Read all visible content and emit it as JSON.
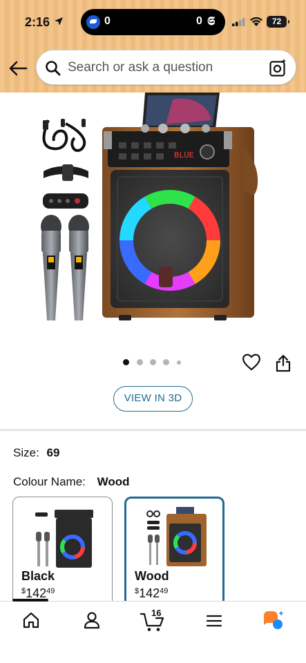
{
  "status_bar": {
    "time": "2:16",
    "score_left": "0",
    "score_right": "0",
    "battery": "72"
  },
  "search": {
    "placeholder": "Search or ask a question"
  },
  "gallery": {
    "dot_count": 5,
    "active_index": 0,
    "view_3d_label": "VIEW IN 3D",
    "speaker_display_text": "BLUE"
  },
  "product": {
    "size_label": "Size:",
    "size_value": "69",
    "colour_label": "Colour Name:",
    "colour_value": "Wood",
    "variants": [
      {
        "name": "Black",
        "currency": "$",
        "price_whole": "142",
        "price_cents": "49",
        "selected": false
      },
      {
        "name": "Wood",
        "currency": "$",
        "price_whole": "142",
        "price_cents": "49",
        "selected": true
      }
    ]
  },
  "bottom_nav": {
    "items": [
      "home-icon",
      "account-icon",
      "cart-icon",
      "menu-icon",
      "rufus-icon"
    ],
    "cart_count": "16",
    "active": "home"
  },
  "colors": {
    "accent": "#1f6a8f",
    "header_bg": "#f3c58b",
    "rufus_orange": "#ff7f2a",
    "rufus_blue": "#1a8cff"
  }
}
